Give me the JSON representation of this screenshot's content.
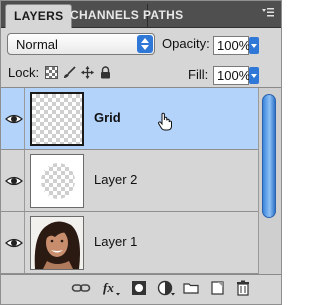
{
  "tabs": [
    {
      "label": "LAYERS",
      "active": true
    },
    {
      "label": "CHANNELS",
      "active": false
    },
    {
      "label": "PATHS",
      "active": false
    }
  ],
  "blend_mode": "Normal",
  "opacity_label": "Opacity:",
  "opacity_value": "100%",
  "lock_label": "Lock:",
  "fill_label": "Fill:",
  "fill_value": "100%",
  "layers": [
    {
      "name": "Grid",
      "selected": true,
      "visible": true,
      "thumbnail": "transparent-checkerboard"
    },
    {
      "name": "Layer 2",
      "selected": false,
      "visible": true,
      "thumbnail": "checkerboard-circle"
    },
    {
      "name": "Layer 1",
      "selected": false,
      "visible": true,
      "thumbnail": "portrait-photo"
    }
  ],
  "toolbar_icons": [
    "link-layers-icon",
    "fx-icon",
    "layer-mask-icon",
    "adjustment-layer-icon",
    "group-folder-icon",
    "new-layer-icon",
    "trash-icon"
  ],
  "colors": {
    "tab_bar": "#4f4f4f",
    "panel_bg": "#d6d6d6",
    "selected_row": "#b4d3fb",
    "accent_blue": "#2f78d8"
  }
}
